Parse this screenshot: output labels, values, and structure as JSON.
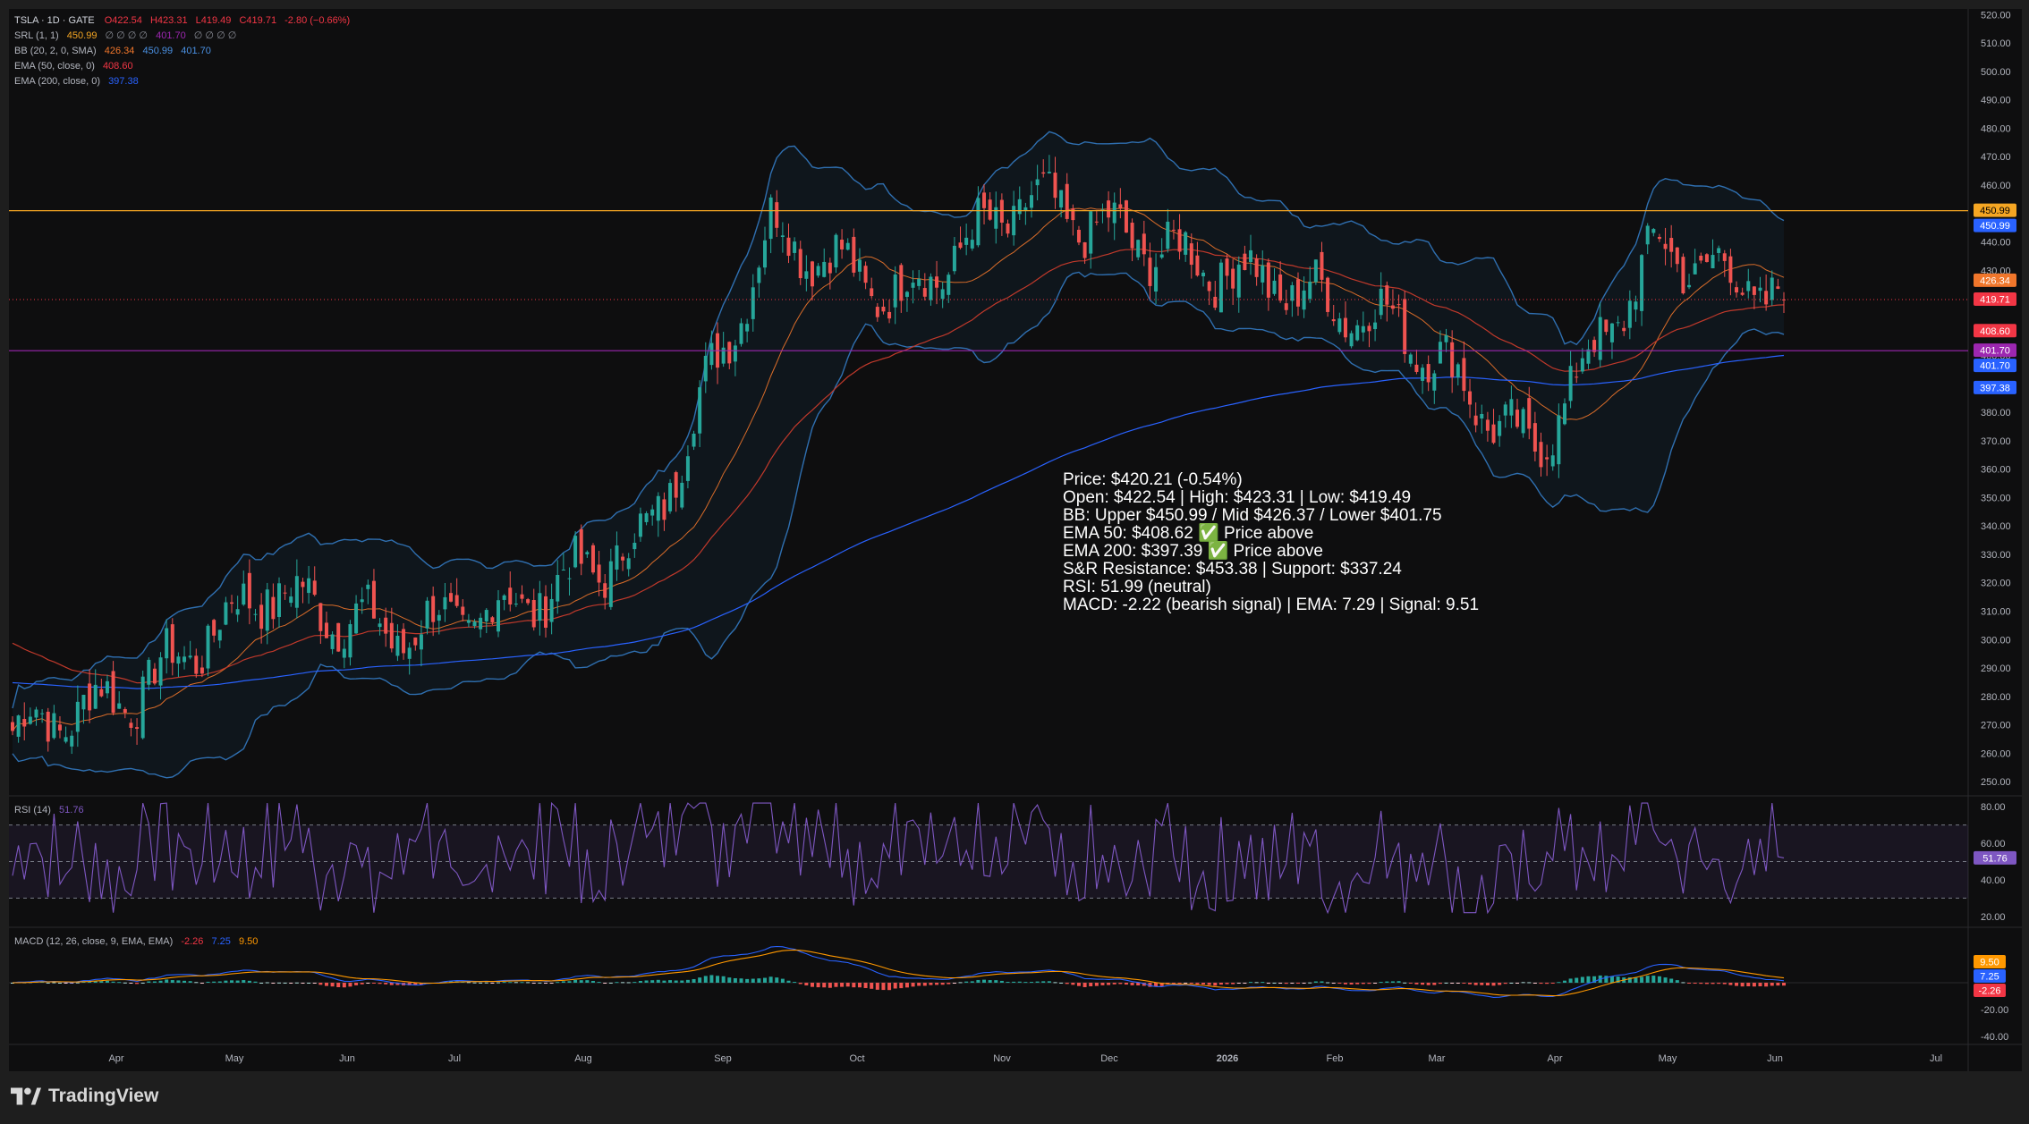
{
  "legend": {
    "symbol": "TSLA · 1D · GATE",
    "ohlc": {
      "o": "O422.54",
      "h": "H423.31",
      "l": "L419.49",
      "c": "C419.71",
      "chg": "-2.80 (−0.66%)"
    },
    "srl": {
      "name": "SRL (1, 1)",
      "v1": "450.99",
      "dots1": "∅ ∅ ∅ ∅",
      "v2": "401.70",
      "dots2": "∅ ∅ ∅ ∅"
    },
    "bb": {
      "name": "BB (20, 2, 0, SMA)",
      "mid": "426.34",
      "upper": "450.99",
      "lower": "401.70"
    },
    "ema50": {
      "name": "EMA (50, close, 0)",
      "value": "408.60"
    },
    "ema200": {
      "name": "EMA (200, close, 0)",
      "value": "397.38"
    },
    "rsi": {
      "name": "RSI (14)",
      "value": "51.76"
    },
    "macd": {
      "name": "MACD (12, 26, close, 9, EMA, EMA)",
      "hist": "-2.26",
      "macd": "7.25",
      "signal": "9.50"
    }
  },
  "price_axis_ticks": [
    "520.00",
    "510.00",
    "500.00",
    "490.00",
    "480.00",
    "470.00",
    "460.00",
    "450.00",
    "440.00",
    "430.00",
    "420.00",
    "410.00",
    "400.00",
    "390.00",
    "380.00",
    "370.00",
    "360.00",
    "350.00",
    "340.00",
    "330.00",
    "320.00",
    "310.00",
    "300.00",
    "290.00",
    "280.00",
    "270.00",
    "260.00",
    "250.00"
  ],
  "rsi_axis_ticks": [
    "80.00",
    "60.00",
    "40.00",
    "20.00"
  ],
  "macd_axis_ticks": [
    "-20.00",
    "-40.00"
  ],
  "time_axis": [
    "Apr",
    "May",
    "Jun",
    "Jul",
    "Aug",
    "Sep",
    "Oct",
    "Nov",
    "Dec",
    "2026",
    "Feb",
    "Mar",
    "Apr",
    "May",
    "Jun",
    "Jul"
  ],
  "price_badges": [
    {
      "label": "450.99",
      "color": "#f5a623",
      "text": "#000000"
    },
    {
      "label": "450.99",
      "color": "#2962ff",
      "text": "#ffffff"
    },
    {
      "label": "426.34",
      "color": "#f0762b",
      "text": "#ffffff"
    },
    {
      "label": "419.71",
      "color": "#f23645",
      "text": "#ffffff"
    },
    {
      "label": "408.60",
      "color": "#f23645",
      "text": "#ffffff"
    },
    {
      "label": "401.70",
      "color": "#9c27b0",
      "text": "#ffffff"
    },
    {
      "label": "401.70",
      "color": "#2962ff",
      "text": "#ffffff"
    },
    {
      "label": "397.38",
      "color": "#2962ff",
      "text": "#ffffff"
    }
  ],
  "indicator_badges": {
    "rsi": {
      "label": "51.76",
      "color": "#7e57c2"
    },
    "macd_signal": {
      "label": "9.50",
      "color": "#ff9800"
    },
    "macd_line": {
      "label": "7.25",
      "color": "#2962ff"
    },
    "macd_hist": {
      "label": "-2.26",
      "color": "#f23645"
    }
  },
  "annotation_lines": [
    "Price: $420.21 (-0.54%)",
    "Open: $422.54 | High: $423.31 | Low: $419.49",
    "BB: Upper $450.99 / Mid $426.37 / Lower $401.75",
    "EMA 50: $408.62 ✅ Price above",
    "EMA 200: $397.39 ✅ Price above",
    "S&R Resistance: $453.38 | Support: $337.24",
    "RSI: 51.99 (neutral)",
    "MACD: -2.22 (bearish signal) | EMA: 7.29 | Signal: 9.51"
  ],
  "brand": "TradingView",
  "colors": {
    "up": "#26a69a",
    "down": "#ef5350",
    "bb": "#2f6fb0",
    "ema50": "#e8742a",
    "ema200": "#2962ff",
    "resistance": "#f5a623",
    "support": "#9c27b0",
    "rsi": "#7e57c2"
  },
  "chart_data": {
    "type": "line",
    "title": "TSLA · 1D · GATE",
    "x": [
      "Apr",
      "May",
      "Jun",
      "Jul",
      "Aug",
      "Sep",
      "Oct",
      "Nov",
      "Dec",
      "2026",
      "Feb",
      "Mar",
      "Apr",
      "May",
      "Jun"
    ],
    "ylim": [
      245,
      522
    ],
    "series": [
      {
        "name": "TSLA",
        "values": [
          268,
          282,
          318,
          302,
          312,
          335,
          445,
          420,
          455,
          438,
          425,
          410,
          365,
          438,
          420
        ]
      },
      {
        "name": "EMA (50, close, 0)",
        "values": [
          300,
          285,
          298,
          302,
          308,
          322,
          388,
          412,
          428,
          436,
          430,
          416,
          398,
          404,
          408.6
        ]
      },
      {
        "name": "EMA (200, close, 0)",
        "values": [
          285,
          282,
          288,
          295,
          302,
          314,
          335,
          358,
          375,
          388,
          396,
          399,
          396,
          394,
          397.38
        ]
      }
    ],
    "horizontal_lines": [
      {
        "name": "Resistance",
        "value": 450.99
      },
      {
        "name": "Support",
        "value": 401.7
      }
    ],
    "rsi": {
      "name": "RSI (14)",
      "last": 51.76,
      "ylim": [
        20,
        80
      ]
    },
    "macd": {
      "name": "MACD (12, 26, close, 9, EMA, EMA)",
      "macd": 7.25,
      "signal": 9.5,
      "hist": -2.26
    }
  }
}
